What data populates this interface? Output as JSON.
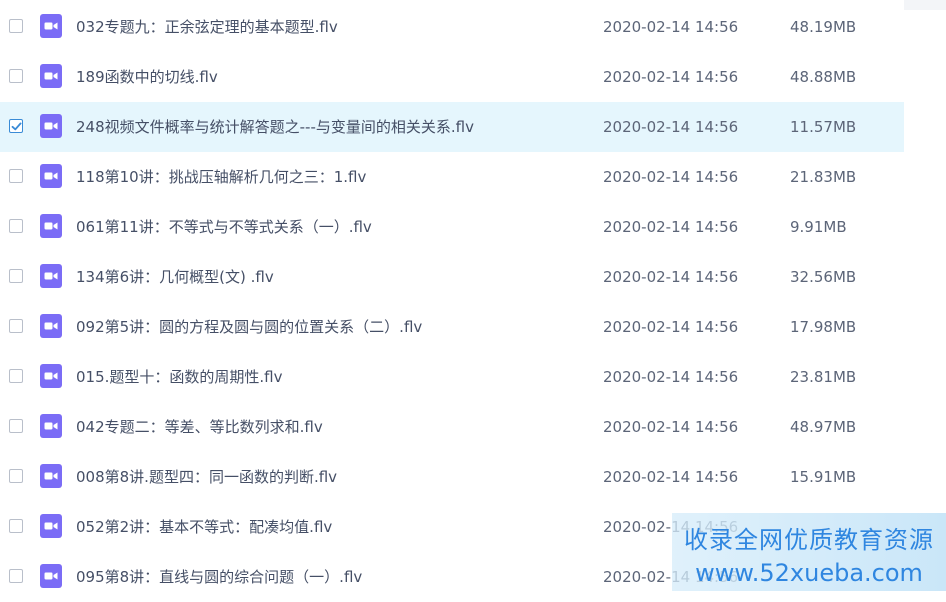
{
  "files": [
    {
      "name": "032专题九：正余弦定理的基本题型.flv",
      "date": "2020-02-14 14:56",
      "size": "48.19MB",
      "selected": false
    },
    {
      "name": "189函数中的切线.flv",
      "date": "2020-02-14 14:56",
      "size": "48.88MB",
      "selected": false
    },
    {
      "name": "248视频文件概率与统计解答题之---与变量间的相关关系.flv",
      "date": "2020-02-14 14:56",
      "size": "11.57MB",
      "selected": true
    },
    {
      "name": "118第10讲：挑战压轴解析几何之三：1.flv",
      "date": "2020-02-14 14:56",
      "size": "21.83MB",
      "selected": false
    },
    {
      "name": "061第11讲：不等式与不等式关系（一）.flv",
      "date": "2020-02-14 14:56",
      "size": "9.91MB",
      "selected": false
    },
    {
      "name": "134第6讲：几何概型(文) .flv",
      "date": "2020-02-14 14:56",
      "size": "32.56MB",
      "selected": false
    },
    {
      "name": "092第5讲：圆的方程及圆与圆的位置关系（二）.flv",
      "date": "2020-02-14 14:56",
      "size": "17.98MB",
      "selected": false
    },
    {
      "name": "015.题型十：函数的周期性.flv",
      "date": "2020-02-14 14:56",
      "size": "23.81MB",
      "selected": false
    },
    {
      "name": "042专题二：等差、等比数列求和.flv",
      "date": "2020-02-14 14:56",
      "size": "48.97MB",
      "selected": false
    },
    {
      "name": "008第8讲.题型四：同一函数的判断.flv",
      "date": "2020-02-14 14:56",
      "size": "15.91MB",
      "selected": false
    },
    {
      "name": "052第2讲：基本不等式：配凑均值.flv",
      "date": "2020-02-14 14:56",
      "size": "",
      "selected": false
    },
    {
      "name": "095第8讲：直线与圆的综合问题（一）.flv",
      "date": "2020-02-14 14:56",
      "size": "",
      "selected": false
    }
  ],
  "watermark": {
    "line1": "收录全网优质教育资源",
    "line2": "www.52xueba.com"
  },
  "colors": {
    "icon": "#7b6cf6",
    "selected_row": "#e5f6fd",
    "check": "#3a8bd6"
  },
  "icons": {
    "file": "video-file-icon",
    "check": "checkmark-icon"
  }
}
